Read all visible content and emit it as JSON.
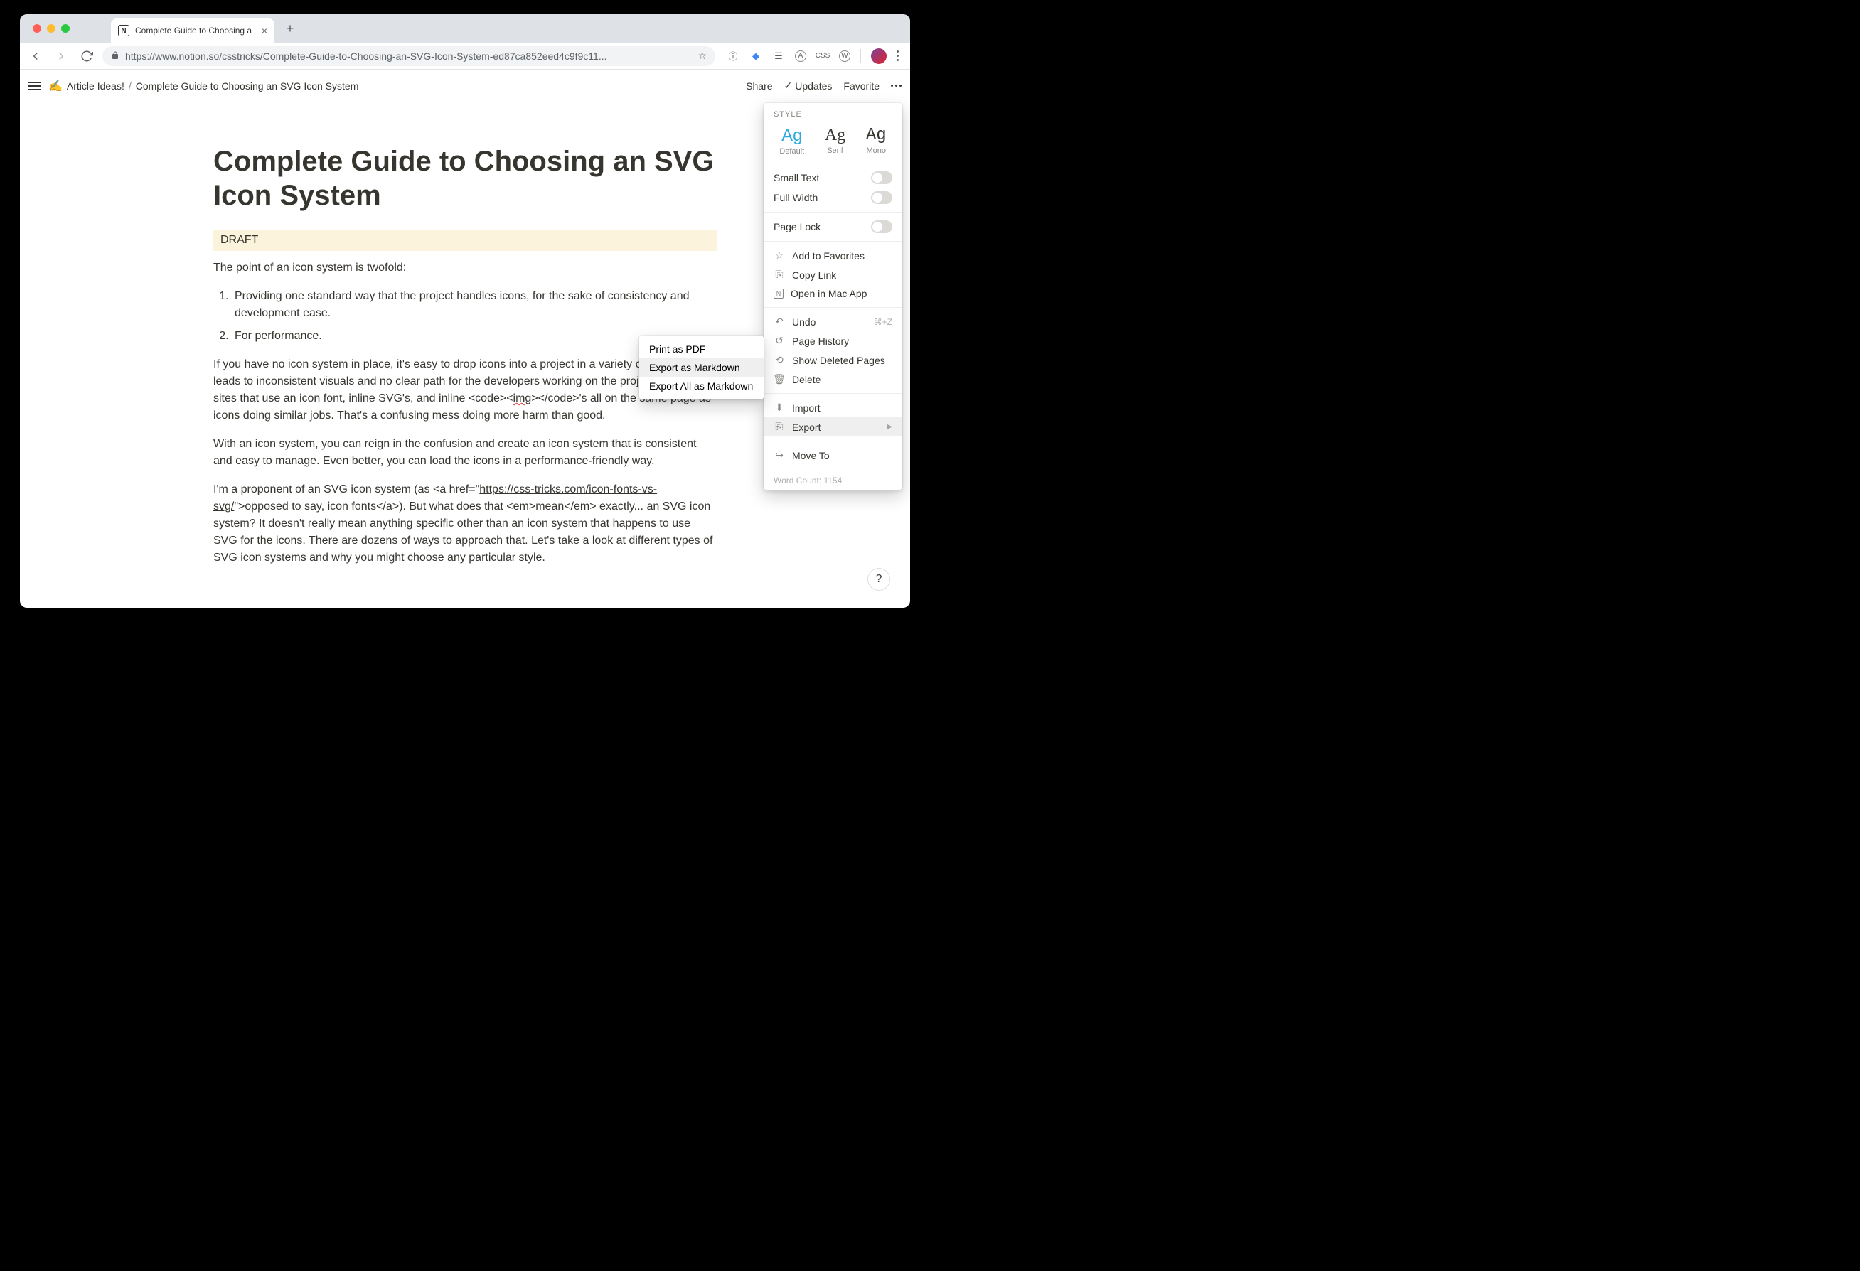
{
  "browser": {
    "tab_title": "Complete Guide to Choosing a",
    "url_display": "https://www.notion.so/csstricks/Complete-Guide-to-Choosing-an-SVG-Icon-System-ed87ca852eed4c9f9c11..."
  },
  "topbar": {
    "breadcrumb_emoji": "✍️",
    "breadcrumb_parent": "Article Ideas!",
    "breadcrumb_current": "Complete Guide to Choosing an SVG Icon System",
    "share": "Share",
    "updates": "Updates",
    "favorite": "Favorite"
  },
  "page": {
    "title": "Complete Guide to Choosing an SVG Icon System",
    "draft_label": "DRAFT",
    "intro": "The point of an icon system is twofold:",
    "list": [
      "Providing one standard way that the project handles icons, for the sake of consistency and development ease.",
      "For performance."
    ],
    "p1_a": "If you have no icon system in place, it's easy to drop icons into a project in a variety of ways that leads to inconsistent visuals and no clear path for the developers working on the project. I've seen sites that use an icon font, inline SVG's, and inline <code><",
    "p1_img": "img",
    "p1_b": "></code>'s all on the same page as icons doing similar jobs. That's a confusing mess doing more harm than good.",
    "p2": "With an icon system, you can reign in the confusion and create an icon system that is consistent and easy to manage. Even better, you can load the icons in a performance-friendly way.",
    "p3_a": "I'm a proponent of an SVG icon system (as <a href=\"",
    "p3_link": "https://css-tricks.com/icon-fonts-vs-svg/",
    "p3_b": "\">opposed to say, icon fonts</a>). But what does that <em>mean</em> exactly... an SVG icon system? It doesn't really mean anything specific other than an icon system that happens to use SVG for the icons. There are dozens of ways to approach that. Let's take a look at different types of SVG icon systems and why you might choose any particular style."
  },
  "menu": {
    "style_header": "STYLE",
    "style_default": "Default",
    "style_serif": "Serif",
    "style_mono": "Mono",
    "small_text": "Small Text",
    "full_width": "Full Width",
    "page_lock": "Page Lock",
    "add_favorites": "Add to Favorites",
    "copy_link": "Copy Link",
    "open_mac": "Open in Mac App",
    "undo": "Undo",
    "undo_kbd": "⌘+Z",
    "page_history": "Page History",
    "show_deleted": "Show Deleted Pages",
    "delete": "Delete",
    "import": "Import",
    "export": "Export",
    "move_to": "Move To",
    "word_count": "Word Count: 1154"
  },
  "submenu": {
    "print_pdf": "Print as PDF",
    "export_md": "Export as Markdown",
    "export_all_md": "Export All as Markdown"
  },
  "help": "?"
}
